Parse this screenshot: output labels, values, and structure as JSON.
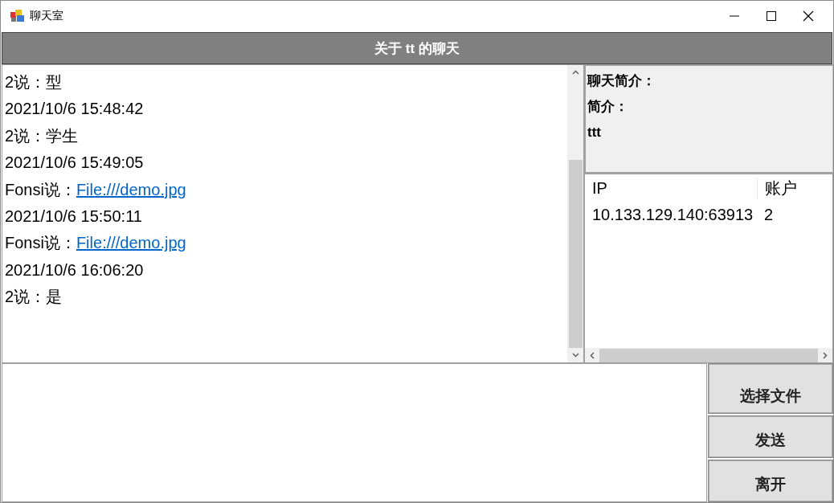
{
  "window": {
    "title": "聊天室"
  },
  "header": {
    "title": "关于 tt 的聊天"
  },
  "messages": [
    {
      "kind": "text",
      "text": "2说：型"
    },
    {
      "kind": "time",
      "text": "2021/10/6 15:48:42"
    },
    {
      "kind": "text",
      "text": "2说：学生"
    },
    {
      "kind": "time",
      "text": "2021/10/6 15:49:05"
    },
    {
      "kind": "link",
      "text": "Fonsi说：",
      "link": "File:///demo.jpg"
    },
    {
      "kind": "time",
      "text": "2021/10/6 15:50:11"
    },
    {
      "kind": "link",
      "text": "Fonsi说：",
      "link": "File:///demo.jpg"
    },
    {
      "kind": "time",
      "text": "2021/10/6 16:06:20"
    },
    {
      "kind": "text",
      "text": "2说：是"
    }
  ],
  "info": {
    "heading": "聊天简介：",
    "label": "简介：",
    "value": "ttt"
  },
  "members": {
    "columns": [
      "IP",
      "账户"
    ],
    "rows": [
      [
        "10.133.129.140:63913",
        "2"
      ]
    ]
  },
  "buttons": [
    "选择文件",
    "发送",
    "离开"
  ]
}
